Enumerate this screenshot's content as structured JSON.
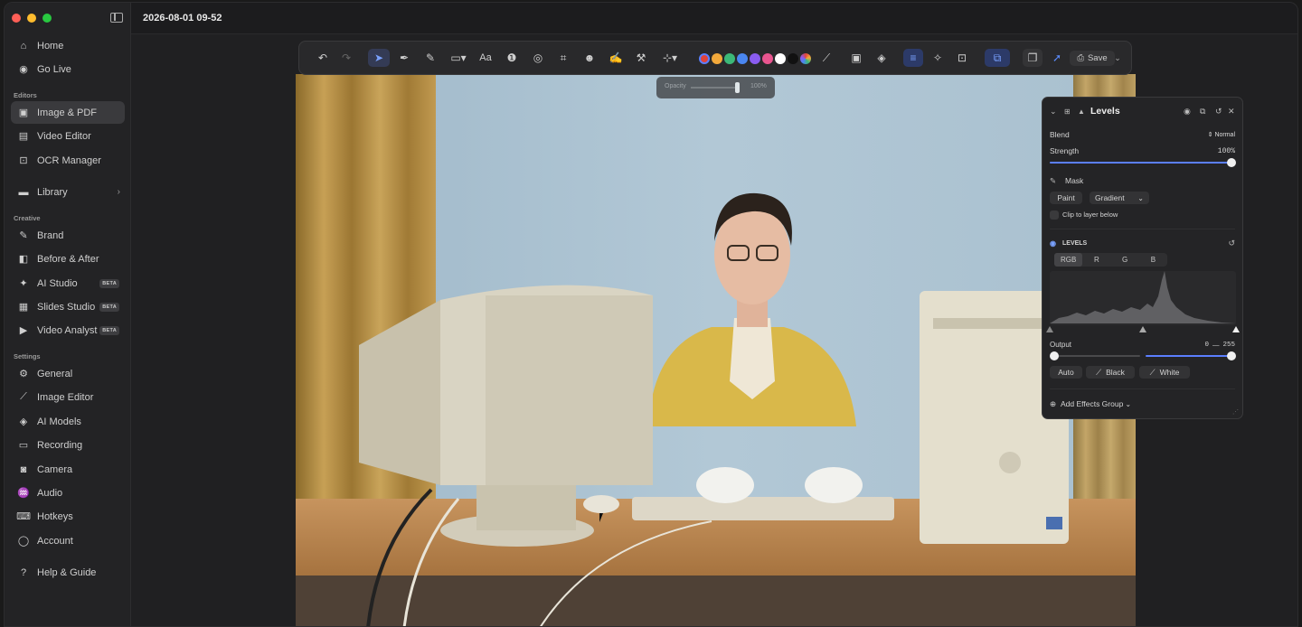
{
  "window": {
    "title": "2026-08-01 09-52"
  },
  "sidebar": {
    "top_items": [
      {
        "label": "Home",
        "icon": "home-icon"
      },
      {
        "label": "Go Live",
        "icon": "broadcast-icon"
      }
    ],
    "sections": {
      "editors": "Editors",
      "creative": "Creative",
      "settings": "Settings"
    },
    "editors": [
      {
        "label": "Image & PDF",
        "icon": "image-pdf-icon",
        "active": true
      },
      {
        "label": "Video Editor",
        "icon": "video-editor-icon"
      },
      {
        "label": "OCR Manager",
        "icon": "ocr-icon"
      }
    ],
    "library": {
      "label": "Library",
      "icon": "folder-icon"
    },
    "creative": [
      {
        "label": "Brand",
        "icon": "brand-icon"
      },
      {
        "label": "Before & After",
        "icon": "before-after-icon"
      },
      {
        "label": "AI Studio",
        "icon": "ai-studio-icon",
        "badge": "BETA"
      },
      {
        "label": "Slides Studio",
        "icon": "slides-icon",
        "badge": "BETA"
      },
      {
        "label": "Video Analyst",
        "icon": "video-analyst-icon",
        "badge": "BETA"
      }
    ],
    "settings": [
      {
        "label": "General",
        "icon": "gear-icon"
      },
      {
        "label": "Image Editor",
        "icon": "image-editor-icon"
      },
      {
        "label": "AI Models",
        "icon": "layers-icon"
      },
      {
        "label": "Recording",
        "icon": "recording-icon"
      },
      {
        "label": "Camera",
        "icon": "camera-icon"
      },
      {
        "label": "Audio",
        "icon": "audio-icon"
      },
      {
        "label": "Hotkeys",
        "icon": "keyboard-icon"
      },
      {
        "label": "Account",
        "icon": "account-icon"
      }
    ],
    "help": {
      "label": "Help & Guide",
      "icon": "help-icon"
    }
  },
  "toolbar": {
    "text_tool_label": "Aa",
    "save_label": "Save",
    "swatches": [
      "#e0433b",
      "#f2a93b",
      "#3cb878",
      "#4a86f0",
      "#8a5cf0",
      "#e9558f",
      "#ffffff",
      "#111111"
    ]
  },
  "opacity": {
    "label": "Opacity",
    "value": "100%",
    "level": 1.0
  },
  "panel": {
    "title": "Levels",
    "blend_label": "Blend",
    "blend_value": "Normal",
    "strength_label": "Strength",
    "strength_value": "100%",
    "strength_level": 1.0,
    "mask_label": "Mask",
    "paint_label": "Paint",
    "gradient_label": "Gradient",
    "clip_label": "Clip to layer below",
    "levels_section": "LEVELS",
    "channels": [
      "RGB",
      "R",
      "G",
      "B"
    ],
    "active_channel": "RGB",
    "output_label": "Output",
    "output_min": "0",
    "output_sep": "—",
    "output_max": "255",
    "auto_label": "Auto",
    "black_label": "Black",
    "white_label": "White",
    "add_effects_label": "Add Effects Group",
    "accent": "#5b7fff"
  }
}
